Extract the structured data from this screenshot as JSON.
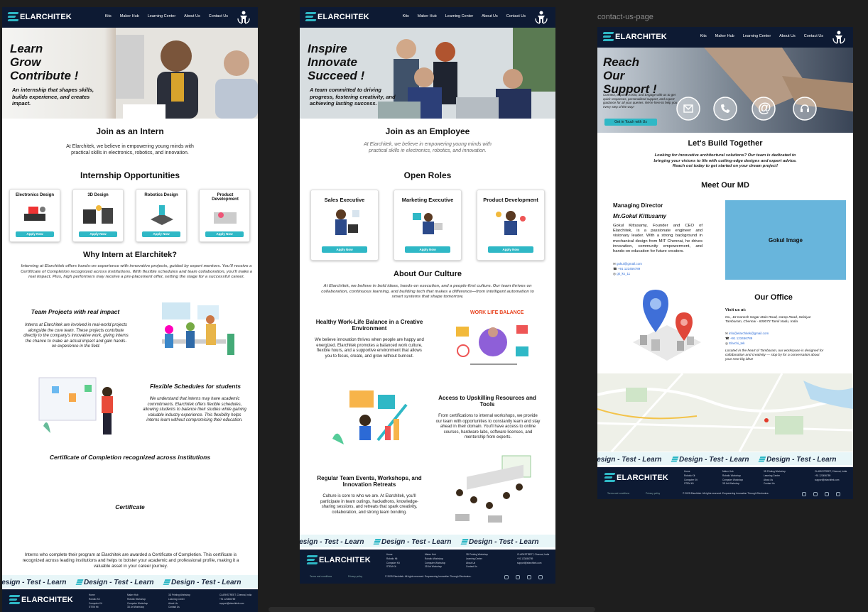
{
  "frame_label": "contact-us-page",
  "brand": {
    "name": "ELARCHITEK",
    "tagline": "EMPOWERING INNOVATION"
  },
  "nav": [
    "Kits",
    "Maker Hub",
    "Learning Center",
    "About Us",
    "Contact Us"
  ],
  "intern": {
    "hero_lines": [
      "Learn",
      "Grow",
      "Contribute !"
    ],
    "hero_sub": "An internship that shapes skills, builds experience, and creates impact.",
    "join_title": "Join as an Intern",
    "join_text": "At Elarchitek, we believe in empowering young minds with practical skills in electronics, robotics, and innovation.",
    "opps_title": "Internship Opportunities",
    "cards": [
      {
        "title": "Electronics Design",
        "btn": "Apply Now"
      },
      {
        "title": "3D Design",
        "btn": "Apply Now"
      },
      {
        "title": "Robotics Design",
        "btn": "Apply Now"
      },
      {
        "title": "Product Development",
        "btn": "Apply Now"
      }
    ],
    "why_title": "Why Intern at Elarchitek?",
    "why_text": "Interning at Elarchitek offers hands-on experience with innovative projects, guided by expert mentors. You'll receive a Certificate of Completion recognized across institutions. With flexible schedules and team collaboration, you'll make a real impact. Plus, high performers may receive a pre-placement offer, setting the stage for a successful career.",
    "f1_title": "Team Projects with real impact",
    "f1_text": "Interns at Elarchitek are involved in real-world projects alongside the core team. These projects contribute directly to the company's innovative work, giving interns the chance to make an actual impact and gain hands-on experience in the field.",
    "f2_title": "Flexible Schedules for students",
    "f2_text": "We understand that interns may have academic commitments. Elarchitek offers flexible schedules, allowing students to balance their studies while gaining valuable industry experience. This flexibility helps interns learn without compromising their education.",
    "f3_title": "Certificate of Completion recognized across institutions",
    "cert_label": "Certificate",
    "cert_text": "Interns who complete their program at Elarchitek are awarded a Certificate of Completion. This certificate is recognized across leading institutions and helps to bolster your academic and professional profile, making it a valuable asset in your career journey."
  },
  "employee": {
    "hero_lines": [
      "Inspire",
      "Innovate",
      "Succeed !"
    ],
    "hero_sub": "A team committed to driving progress, fostering creativity, and achieving lasting success.",
    "join_title": "Join as an Employee",
    "join_text": "At Elarchitek, we believe in empowering young minds with practical skills in electronics, robotics, and innovation.",
    "roles_title": "Open Roles",
    "cards": [
      {
        "title": "Sales Executive",
        "btn": "Apply Now"
      },
      {
        "title": "Marketing Executive",
        "btn": "Apply Now"
      },
      {
        "title": "Product Development",
        "btn": "Apply Now"
      }
    ],
    "culture_title": "About Our Culture",
    "culture_text": "At Elarchitek, we believe in bold ideas, hands-on execution, and a people-first culture. Our team thrives on collaboration, continuous learning, and building tech that makes a difference—from intelligent automation to smart systems that shape tomorrow.",
    "wlb_title": "Healthy Work-Life Balance in a Creative Environment",
    "wlb_text": "We believe innovation thrives when people are happy and energized. Elarchitek promotes a balanced work culture, flexible hours, and a supportive environment that allows you to focus, create, and grow without burnout.",
    "wlb_illus": "WORK LIFE BALANCE",
    "up_title": "Access to Upskilling Resources and Tools",
    "up_text": "From certifications to internal workshops, we provide our team with opportunities to constantly learn and stay ahead in their domain. You'll have access to online courses, hardware labs, software licenses, and mentorship from experts.",
    "ev_title": "Regular Team Events, Workshops, and Innovation Retreats",
    "ev_text": "Culture is core to who we are. At Elarchitek, you'll participate in team outings, hackathons, knowledge-sharing sessions, and retreats that spark creativity, collaboration, and strong team bonding."
  },
  "contact": {
    "hero_lines": [
      "Reach",
      "Our",
      "Support !"
    ],
    "hero_sub": "Connect, Inquire, Assist, and Engage with us to get quick responses, personalized support, and expert guidance for all your queries. We're here to help you every step of the way!",
    "hero_btn": "Get in Touch with Us",
    "build_title": "Let's Build Together",
    "build_text": "Looking for innovative architectural solutions? Our team is dedicated to bringing your visions to life with cutting-edge designs and expert advice. Reach out today to get started on your dream project!",
    "md_title": "Meet Our MD",
    "md_role": "Managing Director",
    "md_name": "Mr.Gokul Kittusamy",
    "md_bio": "Gokul Kittusamy, Founder and CEO of Elarchitek, is a passionate engineer and visionary leader. With a strong background in mechanical design from MIT Chennai, he drives innovation, community empowerment, and hands-on education for future creators.",
    "md_email": "gokul@gmail.com",
    "md_phone": "+91 123456789",
    "md_insta": "gk_ks_11",
    "md_image": "Gokul Image",
    "office_title": "Our Office",
    "visit": "Visit us at:",
    "address": "No., 18 Ganesh Nagar Main Road, Camp Road, Selaiyur Tambaram, Chennai - 600073 Tamil Nadu, India",
    "office_email": "info@elarchitek@gmail.com",
    "office_phone": "+91 123456789",
    "office_insta": "Elarchi_tek",
    "office_text": "Located in the heart of Tambaram, our workspace is designed for collaboration and creativity — stop by for a conversation about your next big idea!"
  },
  "marquee": [
    "Design - Test - Learn",
    "Design - Test - Learn",
    "Design - Test - Learn"
  ],
  "footer": {
    "col1": [
      "Home",
      "Robotic Kit",
      "Computer Kit",
      "STEM Kit"
    ],
    "col2": [
      "Maker Hub",
      "Robotic Workshop",
      "Computer Workshop",
      "3D Art Workshop"
    ],
    "col3": [
      "3D Printing Workshop",
      "Learning Center",
      "About Us",
      "Contact Us"
    ],
    "address": "CLARKSTREET, Chennai, India",
    "phone": "+91 123456789",
    "email": "support@elarchitek.com",
    "terms": "Terms and conditions",
    "privacy": "Privacy policy",
    "copyright": "© 2025 Elarchitek. All rights reserved. Empowering Innovation Through Electronics."
  },
  "colors": {
    "navy": "#0d1a33",
    "teal": "#2fb8c6",
    "map_blue": "#4ea8de"
  }
}
